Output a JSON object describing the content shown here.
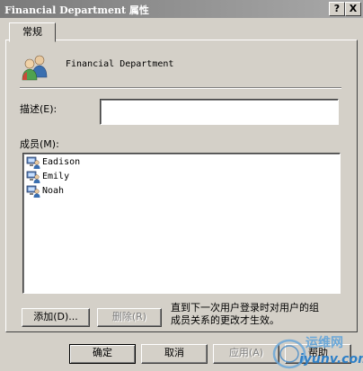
{
  "window": {
    "title": "Financial Department 属性",
    "help_button": "?",
    "close_button": "X"
  },
  "tabs": [
    {
      "label": "常规"
    }
  ],
  "general": {
    "group_name": "Financial Department",
    "description_label": "描述(E):",
    "description_value": "",
    "members_label": "成员(M):",
    "members": [
      {
        "name": "Eadison",
        "icon": "user-icon"
      },
      {
        "name": "Emily",
        "icon": "user-icon"
      },
      {
        "name": "Noah",
        "icon": "user-icon"
      }
    ],
    "add_button": "添加(D)...",
    "remove_button": "删除(R)",
    "note": "直到下一次用户登录时对用户的组\n成员关系的更改才生效。"
  },
  "footer": {
    "ok": "确定",
    "cancel": "取消",
    "apply": "应用(A)",
    "help": "帮助"
  },
  "watermark": {
    "line1": "运维网",
    "line2": "iyunv.com"
  },
  "colors": {
    "titlebar_start": "#7a7a7a",
    "titlebar_end": "#a9a9a9",
    "face": "#d4d0c8",
    "watermark": "#2d7fc7"
  }
}
